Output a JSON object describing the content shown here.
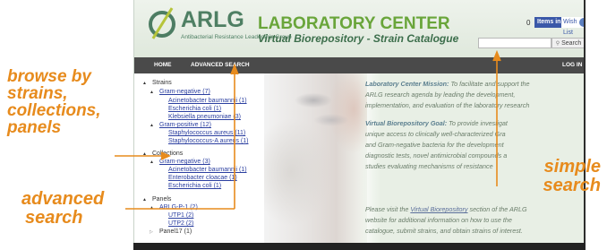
{
  "header": {
    "logo_text": "ARLG",
    "logo_subtitle": "Antibacterial Resistance Leadership Group",
    "title": "LABORATORY CENTER",
    "subtitle": "Virtual Biorepository - Strain Catalogue",
    "items_count": "0",
    "items_label": "Items in",
    "wish_list_label": "Wish List",
    "search_button": "Search"
  },
  "nav": {
    "home": "HOME",
    "advanced_search": "ADVANCED SEARCH",
    "login": "LOG IN"
  },
  "tree": {
    "strains": "Strains",
    "gram_neg": "Gram-negative (7)",
    "acinetobacter": "Acinetobacter baumannii (1)",
    "ecoli": "Escherichia coli (1)",
    "klebsiella": "Klebsiella pneumoniae (3)",
    "gram_pos": "Gram-positive (12)",
    "staph": "Staphylococcus aureus (11)",
    "staph_a": "Staphylococcus-A aureus (1)",
    "collections": "Collections",
    "col_gram_neg": "Gram-negative (3)",
    "col_acinetobacter": "Acinetobacter baumannii (1)",
    "col_enterobacter": "Enterobacter cloacae (1)",
    "col_ecoli": "Escherichia coli (1)",
    "panels": "Panels",
    "arlg": "ARLG-P-1 (2)",
    "utp1": "UTP1 (2)",
    "utp2": "UTP2 (2)",
    "panel17": "Panel17 (1)"
  },
  "content": {
    "mission_label": "Laboratory Center Mission:",
    "mission_1": " To facilitate and support the",
    "mission_2": "ARLG research agenda by leading the development,",
    "mission_3": "implementation, and evaluation of the laboratory research",
    "vb_label": "Virtual Biorepository Goal:",
    "vb_1": " To provide investigat",
    "vb_2": "unique access to clinically well-characterized Gra",
    "vb_3": "and Gram-negative bacteria for the development",
    "vb_4": "diagnostic tests, novel antimicrobial compounds a",
    "vb_5": "studies evaluating mechanisms of resistance",
    "visit_1a": "Please visit the ",
    "visit_link": "Virtual Biorepository",
    "visit_1b": " section of the ARLG",
    "visit_2": "website for additional information on how to use the",
    "visit_3": "catalogue, submit strains, and obtain strains of interest."
  },
  "annotations": {
    "browse_1": "browse by",
    "browse_2": "strains,",
    "browse_3": "collections,",
    "browse_4": "panels",
    "advanced_1": "advanced",
    "advanced_2": "search",
    "simple_1": "simple",
    "simple_2": "search"
  },
  "colors": {
    "annotation": "#e78b1d",
    "nav_bar": "#4a4a4a",
    "logo_green": "#4e7f63",
    "title_green": "#69a53a",
    "link_blue": "#2b3fa0"
  }
}
